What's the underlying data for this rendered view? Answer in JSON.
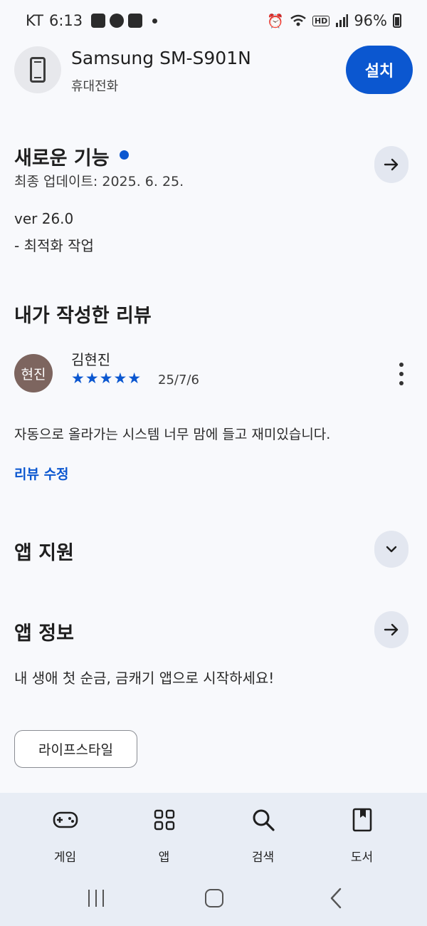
{
  "status_bar": {
    "carrier": "KT",
    "time": "6:13",
    "battery": "96%",
    "network": "HD"
  },
  "app": {
    "title": "Samsung SM-S901N",
    "subtitle": "휴대전화",
    "install_label": "설치"
  },
  "whats_new": {
    "title": "새로운 기능",
    "updated": "최종 업데이트: 2025. 6. 25.",
    "version": "ver 26.0",
    "note": "- 최적화 작업"
  },
  "my_review": {
    "title": "내가 작성한 리뷰",
    "avatar_text": "현진",
    "reviewer": "김현진",
    "rating": 5,
    "stars": "★★★★★",
    "date": "25/7/6",
    "text": "자동으로 올라가는 시스템 너무 맘에 들고 재미있습니다.",
    "edit_label": "리뷰 수정"
  },
  "app_support": {
    "title": "앱 지원"
  },
  "app_info": {
    "title": "앱 정보",
    "description": "내 생애 첫 순금, 금캐기 앱으로 시작하세요!",
    "category_chip": "라이프스타일"
  },
  "bottom_nav": {
    "items": [
      {
        "label": "게임",
        "icon": "gamepad-icon"
      },
      {
        "label": "앱",
        "icon": "apps-grid-icon"
      },
      {
        "label": "검색",
        "icon": "search-icon"
      },
      {
        "label": "도서",
        "icon": "book-icon"
      }
    ]
  },
  "colors": {
    "accent": "#0b57d0",
    "background": "#f8f9fc",
    "nav_background": "#e8edf5",
    "avatar": "#7d655f"
  }
}
